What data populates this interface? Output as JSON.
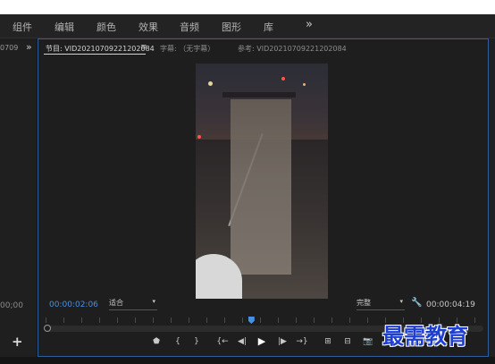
{
  "menu": {
    "items": [
      "组件",
      "编辑",
      "颜色",
      "效果",
      "音频",
      "图形",
      "库"
    ],
    "more": "»"
  },
  "left_panel": {
    "tab": "0709",
    "more": "»",
    "timecode": "00;00",
    "add": "+"
  },
  "monitor": {
    "tabs": {
      "program": "节目: VID20210709221202084",
      "program_menu": "≡",
      "captions": "字幕: （无字幕）",
      "reference": "参考: VID20210709221202084"
    },
    "current_timecode": "00:00:02:06",
    "fit_label": "适合",
    "quality_label": "完整",
    "duration_timecode": "00:00:04:19",
    "accent_color": "#4a90e2",
    "playhead_fraction": 0.47
  },
  "transport": {
    "marker": "⬟",
    "in_point": "{",
    "out_point": "}",
    "go_to_in": "{←",
    "step_back": "◀|",
    "play": "▶",
    "step_forward": "|▶",
    "go_to_out": "→}",
    "lift": "⊞",
    "extract": "⊟",
    "export_frame": "📷"
  },
  "watermark": "最需教育"
}
